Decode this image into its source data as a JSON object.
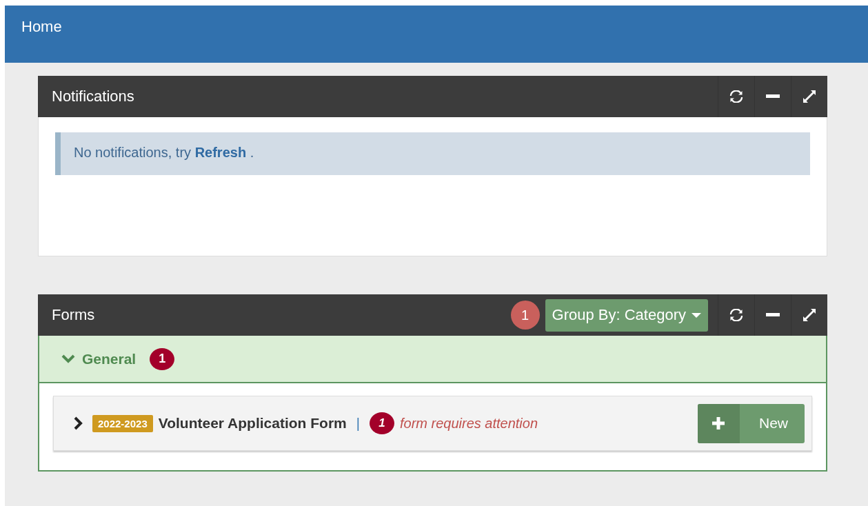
{
  "header": {
    "title": "Home"
  },
  "notifications": {
    "title": "Notifications",
    "message": "No notifications, try **Refresh** ."
  },
  "forms": {
    "title": "Forms",
    "count": "1",
    "group_by": "Group By: Category",
    "groups": [
      {
        "name": "General",
        "count": "1",
        "expanded": true,
        "items": [
          {
            "tag": "2022-2023",
            "name": "Volunteer Application Form",
            "separator": "|",
            "count": "1",
            "note": "form requires attention",
            "expanded": false,
            "action": "New"
          }
        ]
      }
    ]
  }
}
